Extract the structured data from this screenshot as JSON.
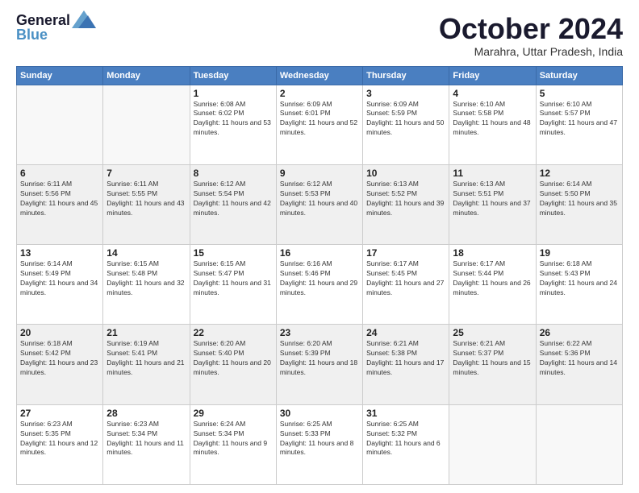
{
  "logo": {
    "line1": "General",
    "line2": "Blue"
  },
  "title": "October 2024",
  "subtitle": "Marahra, Uttar Pradesh, India",
  "headers": [
    "Sunday",
    "Monday",
    "Tuesday",
    "Wednesday",
    "Thursday",
    "Friday",
    "Saturday"
  ],
  "weeks": [
    [
      {
        "day": "",
        "info": ""
      },
      {
        "day": "",
        "info": ""
      },
      {
        "day": "1",
        "info": "Sunrise: 6:08 AM\nSunset: 6:02 PM\nDaylight: 11 hours and 53 minutes."
      },
      {
        "day": "2",
        "info": "Sunrise: 6:09 AM\nSunset: 6:01 PM\nDaylight: 11 hours and 52 minutes."
      },
      {
        "day": "3",
        "info": "Sunrise: 6:09 AM\nSunset: 5:59 PM\nDaylight: 11 hours and 50 minutes."
      },
      {
        "day": "4",
        "info": "Sunrise: 6:10 AM\nSunset: 5:58 PM\nDaylight: 11 hours and 48 minutes."
      },
      {
        "day": "5",
        "info": "Sunrise: 6:10 AM\nSunset: 5:57 PM\nDaylight: 11 hours and 47 minutes."
      }
    ],
    [
      {
        "day": "6",
        "info": "Sunrise: 6:11 AM\nSunset: 5:56 PM\nDaylight: 11 hours and 45 minutes."
      },
      {
        "day": "7",
        "info": "Sunrise: 6:11 AM\nSunset: 5:55 PM\nDaylight: 11 hours and 43 minutes."
      },
      {
        "day": "8",
        "info": "Sunrise: 6:12 AM\nSunset: 5:54 PM\nDaylight: 11 hours and 42 minutes."
      },
      {
        "day": "9",
        "info": "Sunrise: 6:12 AM\nSunset: 5:53 PM\nDaylight: 11 hours and 40 minutes."
      },
      {
        "day": "10",
        "info": "Sunrise: 6:13 AM\nSunset: 5:52 PM\nDaylight: 11 hours and 39 minutes."
      },
      {
        "day": "11",
        "info": "Sunrise: 6:13 AM\nSunset: 5:51 PM\nDaylight: 11 hours and 37 minutes."
      },
      {
        "day": "12",
        "info": "Sunrise: 6:14 AM\nSunset: 5:50 PM\nDaylight: 11 hours and 35 minutes."
      }
    ],
    [
      {
        "day": "13",
        "info": "Sunrise: 6:14 AM\nSunset: 5:49 PM\nDaylight: 11 hours and 34 minutes."
      },
      {
        "day": "14",
        "info": "Sunrise: 6:15 AM\nSunset: 5:48 PM\nDaylight: 11 hours and 32 minutes."
      },
      {
        "day": "15",
        "info": "Sunrise: 6:15 AM\nSunset: 5:47 PM\nDaylight: 11 hours and 31 minutes."
      },
      {
        "day": "16",
        "info": "Sunrise: 6:16 AM\nSunset: 5:46 PM\nDaylight: 11 hours and 29 minutes."
      },
      {
        "day": "17",
        "info": "Sunrise: 6:17 AM\nSunset: 5:45 PM\nDaylight: 11 hours and 27 minutes."
      },
      {
        "day": "18",
        "info": "Sunrise: 6:17 AM\nSunset: 5:44 PM\nDaylight: 11 hours and 26 minutes."
      },
      {
        "day": "19",
        "info": "Sunrise: 6:18 AM\nSunset: 5:43 PM\nDaylight: 11 hours and 24 minutes."
      }
    ],
    [
      {
        "day": "20",
        "info": "Sunrise: 6:18 AM\nSunset: 5:42 PM\nDaylight: 11 hours and 23 minutes."
      },
      {
        "day": "21",
        "info": "Sunrise: 6:19 AM\nSunset: 5:41 PM\nDaylight: 11 hours and 21 minutes."
      },
      {
        "day": "22",
        "info": "Sunrise: 6:20 AM\nSunset: 5:40 PM\nDaylight: 11 hours and 20 minutes."
      },
      {
        "day": "23",
        "info": "Sunrise: 6:20 AM\nSunset: 5:39 PM\nDaylight: 11 hours and 18 minutes."
      },
      {
        "day": "24",
        "info": "Sunrise: 6:21 AM\nSunset: 5:38 PM\nDaylight: 11 hours and 17 minutes."
      },
      {
        "day": "25",
        "info": "Sunrise: 6:21 AM\nSunset: 5:37 PM\nDaylight: 11 hours and 15 minutes."
      },
      {
        "day": "26",
        "info": "Sunrise: 6:22 AM\nSunset: 5:36 PM\nDaylight: 11 hours and 14 minutes."
      }
    ],
    [
      {
        "day": "27",
        "info": "Sunrise: 6:23 AM\nSunset: 5:35 PM\nDaylight: 11 hours and 12 minutes."
      },
      {
        "day": "28",
        "info": "Sunrise: 6:23 AM\nSunset: 5:34 PM\nDaylight: 11 hours and 11 minutes."
      },
      {
        "day": "29",
        "info": "Sunrise: 6:24 AM\nSunset: 5:34 PM\nDaylight: 11 hours and 9 minutes."
      },
      {
        "day": "30",
        "info": "Sunrise: 6:25 AM\nSunset: 5:33 PM\nDaylight: 11 hours and 8 minutes."
      },
      {
        "day": "31",
        "info": "Sunrise: 6:25 AM\nSunset: 5:32 PM\nDaylight: 11 hours and 6 minutes."
      },
      {
        "day": "",
        "info": ""
      },
      {
        "day": "",
        "info": ""
      }
    ]
  ]
}
